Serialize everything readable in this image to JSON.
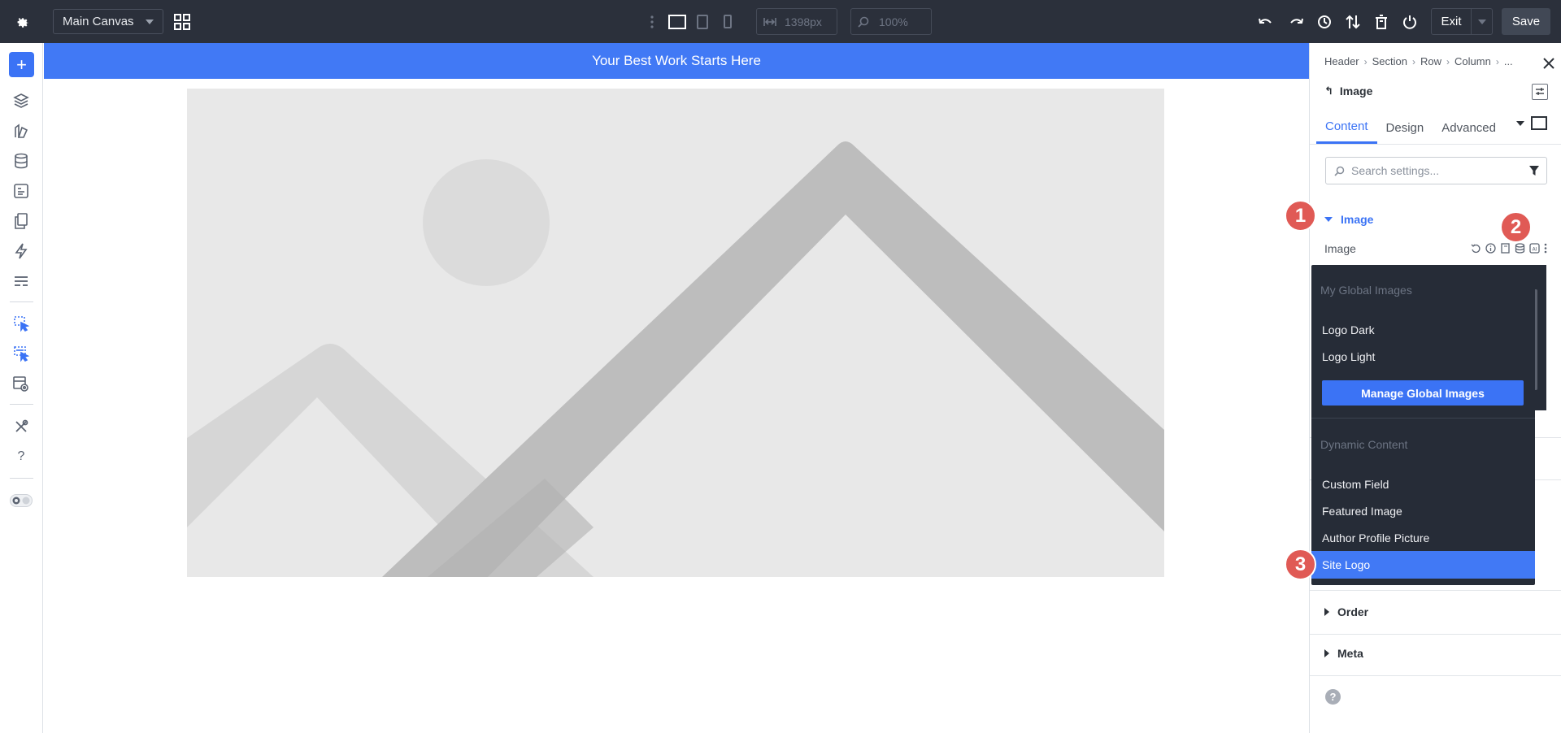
{
  "topbar": {
    "canvas_select": "Main Canvas",
    "width_value": "1398px",
    "zoom_value": "100%",
    "exit_label": "Exit",
    "save_label": "Save"
  },
  "canvas": {
    "banner_text": "Your Best Work Starts Here"
  },
  "panel": {
    "breadcrumb": [
      "Header",
      "Section",
      "Row",
      "Column",
      "..."
    ],
    "module_title": "Image",
    "tabs": [
      "Content",
      "Design",
      "Advanced"
    ],
    "active_tab": "Content",
    "search_placeholder": "Search settings...",
    "image_group": "Image",
    "image_field": "Image",
    "groups_below": [
      "Order",
      "Meta"
    ]
  },
  "dropdown": {
    "global_heading": "My Global Images",
    "global_items": [
      "Logo Dark",
      "Logo Light"
    ],
    "manage_label": "Manage Global Images",
    "dynamic_heading": "Dynamic Content",
    "dynamic_items": [
      "Custom Field",
      "Featured Image",
      "Author Profile Picture",
      "Site Logo"
    ],
    "selected_item": "Site Logo"
  },
  "badges": [
    "1",
    "2",
    "3"
  ],
  "colors": {
    "accent": "#3b73f5",
    "banner": "#4179f5",
    "topbar": "#2b303b",
    "badge": "#e05a55"
  }
}
